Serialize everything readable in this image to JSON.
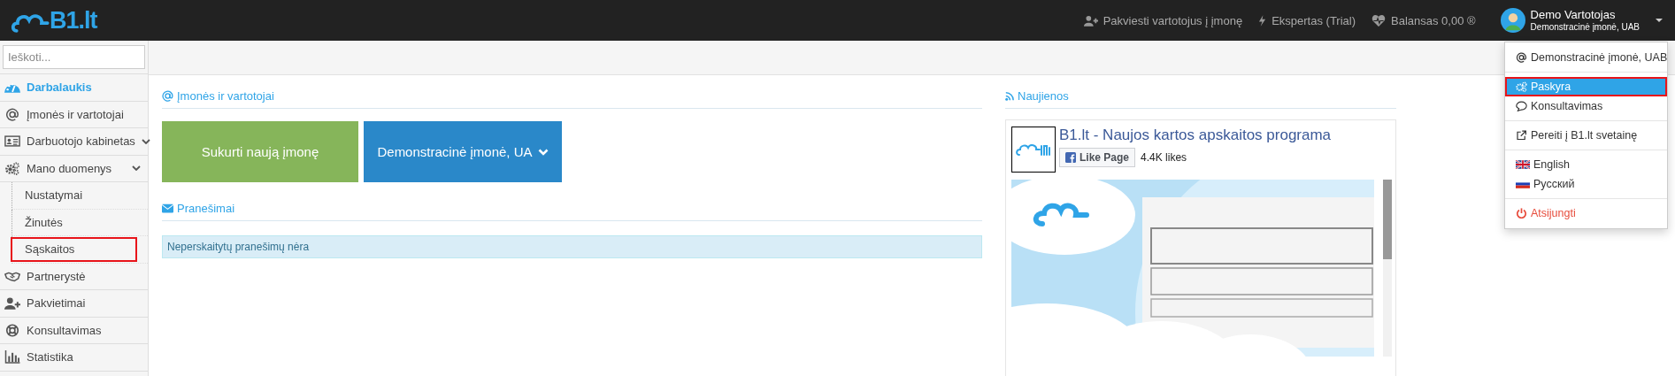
{
  "topbar": {
    "logo": "B1.lt",
    "links": [
      {
        "label": "Pakviesti vartotojus į įmonę",
        "kind": "invite"
      },
      {
        "label": "Ekspertas (Trial)",
        "kind": "plan"
      },
      {
        "label": "Balansas 0,00 ®",
        "kind": "balance"
      }
    ],
    "user": {
      "name": "Demo Vartotojas",
      "company": "Demonstracinė įmonė, UAB"
    }
  },
  "sidebar": {
    "search": {
      "placeholder": "Ieškoti..."
    },
    "items": [
      {
        "label": "Darbalaukis",
        "kind": "dashboard",
        "selected": true
      },
      {
        "label": "Įmonės ir vartotojai",
        "kind": "companies",
        "selected": false
      },
      {
        "label": "Darbuotojo kabinetas",
        "kind": "cabinet",
        "selected": false,
        "submenu": true
      },
      {
        "label": "Mano duomenys",
        "kind": "data",
        "selected": false,
        "submenu": true,
        "children": [
          {
            "label": "Nustatymai",
            "highlighted": false
          },
          {
            "label": "Žinutės",
            "highlighted": false
          },
          {
            "label": "Sąskaitos",
            "highlighted": true
          }
        ]
      },
      {
        "label": "Partnerystė",
        "kind": "partners",
        "selected": false
      },
      {
        "label": "Pakvietimai",
        "kind": "invites",
        "selected": false
      },
      {
        "label": "Konsultavimas",
        "kind": "help",
        "selected": false
      },
      {
        "label": "Statistika",
        "kind": "stats",
        "selected": false
      }
    ]
  },
  "companies": {
    "title": "Įmonės ir vartotojai",
    "create_button": "Sukurti naują įmonę",
    "company_select": "Demonstracinė įmonė, UA"
  },
  "messages": {
    "title": "Pranešimai",
    "empty": "Neperskaitytų pranešimų nėra"
  },
  "news": {
    "title": "Naujienos",
    "page_title": "B1.lt - Naujos kartos apskaitos programa",
    "like_button": "Like Page",
    "likes": "4.4K likes"
  },
  "user_menu": {
    "groups": [
      [
        {
          "label": "Demonstracinė įmonė, UAB",
          "kind": "company",
          "selected": false,
          "highlighted": false
        }
      ],
      [
        {
          "label": "Paskyra",
          "kind": "account",
          "selected": true,
          "highlighted": true
        },
        {
          "label": "Konsultavimas",
          "kind": "help",
          "selected": false,
          "highlighted": false
        }
      ],
      [
        {
          "label": "Pereiti į B1.lt svetainę",
          "kind": "site",
          "selected": false,
          "highlighted": false
        }
      ],
      [
        {
          "label": "English",
          "kind": "lang-en",
          "selected": false,
          "highlighted": false
        },
        {
          "label": "Русский",
          "kind": "lang-ru",
          "selected": false,
          "highlighted": false
        }
      ],
      [
        {
          "label": "Atsijungti",
          "kind": "logout",
          "selected": false,
          "highlighted": false
        }
      ]
    ]
  }
}
